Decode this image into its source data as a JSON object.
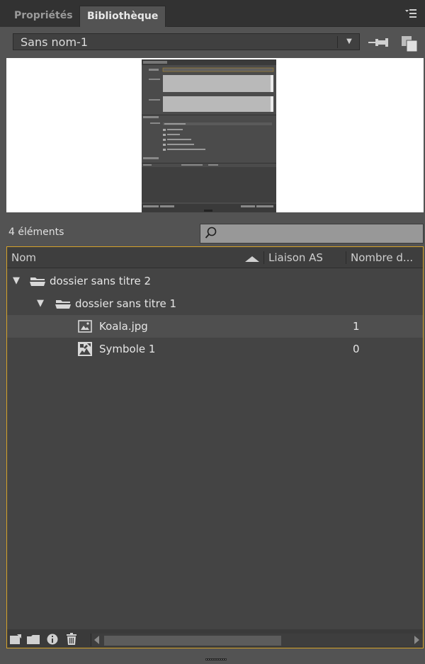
{
  "tabs": [
    {
      "label": "Propriétés",
      "active": false
    },
    {
      "label": "Bibliothèque",
      "active": true
    }
  ],
  "panel_menu_icon": "panel-menu-icon",
  "library": {
    "selected": "Sans nom-1"
  },
  "status": {
    "count_text": "4 éléments",
    "search_value": ""
  },
  "columns": {
    "name": "Nom",
    "linkage": "Liaison AS",
    "usage": "Nombre d..."
  },
  "items": [
    {
      "label": "dossier sans titre 2",
      "type": "folder",
      "depth": 0,
      "expanded": true,
      "usage": ""
    },
    {
      "label": "dossier sans titre 1",
      "type": "folder",
      "depth": 1,
      "expanded": true,
      "usage": ""
    },
    {
      "label": "Koala.jpg",
      "type": "bitmap",
      "depth": 2,
      "selected": true,
      "usage": "1"
    },
    {
      "label": "Symbole 1",
      "type": "movieclip",
      "depth": 2,
      "selected": false,
      "usage": "0"
    }
  ],
  "colors": {
    "accent": "#d6a32a",
    "panel": "#535353",
    "list_bg": "#444444"
  }
}
